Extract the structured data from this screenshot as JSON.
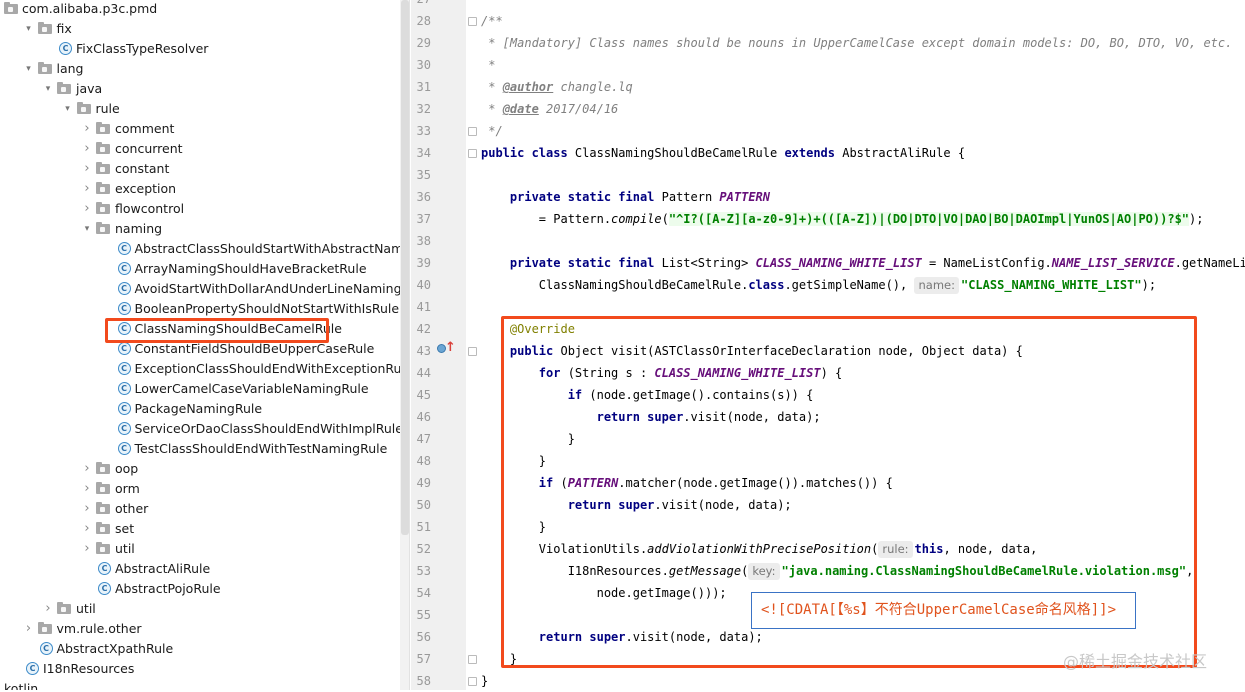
{
  "project_tree": {
    "items": [
      {
        "label": "com.alibaba.p3c.pmd",
        "type": "folder",
        "indent": 0,
        "arrow": ""
      },
      {
        "label": "fix",
        "type": "folder",
        "indent": 1,
        "arrow": "down"
      },
      {
        "label": "FixClassTypeResolver",
        "type": "class",
        "indent": 2,
        "arrow": ""
      },
      {
        "label": "lang",
        "type": "folder",
        "indent": 1,
        "arrow": "down"
      },
      {
        "label": "java",
        "type": "folder",
        "indent": 2,
        "arrow": "down"
      },
      {
        "label": "rule",
        "type": "folder",
        "indent": 3,
        "arrow": "down"
      },
      {
        "label": "comment",
        "type": "folder",
        "indent": 4,
        "arrow": "right"
      },
      {
        "label": "concurrent",
        "type": "folder",
        "indent": 4,
        "arrow": "right"
      },
      {
        "label": "constant",
        "type": "folder",
        "indent": 4,
        "arrow": "right"
      },
      {
        "label": "exception",
        "type": "folder",
        "indent": 4,
        "arrow": "right"
      },
      {
        "label": "flowcontrol",
        "type": "folder",
        "indent": 4,
        "arrow": "right"
      },
      {
        "label": "naming",
        "type": "folder",
        "indent": 4,
        "arrow": "down"
      },
      {
        "label": "AbstractClassShouldStartWithAbstractNamingRule",
        "type": "class",
        "indent": 5,
        "arrow": ""
      },
      {
        "label": "ArrayNamingShouldHaveBracketRule",
        "type": "class",
        "indent": 5,
        "arrow": ""
      },
      {
        "label": "AvoidStartWithDollarAndUnderLineNamingRule",
        "type": "class",
        "indent": 5,
        "arrow": ""
      },
      {
        "label": "BooleanPropertyShouldNotStartWithIsRule",
        "type": "class",
        "indent": 5,
        "arrow": ""
      },
      {
        "label": "ClassNamingShouldBeCamelRule",
        "type": "class",
        "indent": 5,
        "arrow": ""
      },
      {
        "label": "ConstantFieldShouldBeUpperCaseRule",
        "type": "class",
        "indent": 5,
        "arrow": ""
      },
      {
        "label": "ExceptionClassShouldEndWithExceptionRule",
        "type": "class",
        "indent": 5,
        "arrow": ""
      },
      {
        "label": "LowerCamelCaseVariableNamingRule",
        "type": "class",
        "indent": 5,
        "arrow": ""
      },
      {
        "label": "PackageNamingRule",
        "type": "class",
        "indent": 5,
        "arrow": ""
      },
      {
        "label": "ServiceOrDaoClassShouldEndWithImplRule",
        "type": "class",
        "indent": 5,
        "arrow": ""
      },
      {
        "label": "TestClassShouldEndWithTestNamingRule",
        "type": "class",
        "indent": 5,
        "arrow": ""
      },
      {
        "label": "oop",
        "type": "folder",
        "indent": 4,
        "arrow": "right"
      },
      {
        "label": "orm",
        "type": "folder",
        "indent": 4,
        "arrow": "right"
      },
      {
        "label": "other",
        "type": "folder",
        "indent": 4,
        "arrow": "right"
      },
      {
        "label": "set",
        "type": "folder",
        "indent": 4,
        "arrow": "right"
      },
      {
        "label": "util",
        "type": "folder",
        "indent": 4,
        "arrow": "right"
      },
      {
        "label": "AbstractAliRule",
        "type": "class",
        "indent": 4,
        "arrow": ""
      },
      {
        "label": "AbstractPojoRule",
        "type": "class",
        "indent": 4,
        "arrow": ""
      },
      {
        "label": "util",
        "type": "folder",
        "indent": 2,
        "arrow": "right"
      },
      {
        "label": "vm.rule.other",
        "type": "folder",
        "indent": 1,
        "arrow": "right"
      },
      {
        "label": "AbstractXpathRule",
        "type": "class",
        "indent": 1,
        "arrow": ""
      },
      {
        "label": "I18nResources",
        "type": "class",
        "indent": 0,
        "arrow": ""
      },
      {
        "label": "kotlin",
        "type": "text",
        "indent": 0,
        "arrow": ""
      }
    ]
  },
  "editor": {
    "line_numbers": [
      "27",
      "28",
      "29",
      "30",
      "31",
      "32",
      "33",
      "34",
      "35",
      "36",
      "37",
      "38",
      "39",
      "40",
      "41",
      "42",
      "43",
      "44",
      "45",
      "46",
      "47",
      "48",
      "49",
      "50",
      "51",
      "52",
      "53",
      "54",
      "55",
      "56",
      "57",
      "58"
    ],
    "lines": [
      [],
      [
        {
          "t": "/**",
          "c": "cm"
        }
      ],
      [
        {
          "t": " * [Mandatory] Class names should be nouns in UpperCamelCase except domain models: DO, BO, DTO, VO, etc.",
          "c": "cm"
        }
      ],
      [
        {
          "t": " *",
          "c": "cm"
        }
      ],
      [
        {
          "t": " * ",
          "c": "cm"
        },
        {
          "t": "@author",
          "c": "tag"
        },
        {
          "t": " changle.lq",
          "c": "cm"
        }
      ],
      [
        {
          "t": " * ",
          "c": "cm"
        },
        {
          "t": "@date",
          "c": "tag"
        },
        {
          "t": " 2017/04/16",
          "c": "cm"
        }
      ],
      [
        {
          "t": " */",
          "c": "cm"
        }
      ],
      [
        {
          "t": "public class ",
          "c": "kw"
        },
        {
          "t": "ClassNamingShouldBeCamelRule ",
          "c": ""
        },
        {
          "t": "extends ",
          "c": "kw"
        },
        {
          "t": "AbstractAliRule {",
          "c": ""
        }
      ],
      [],
      [
        {
          "t": "    private static final ",
          "c": "kw"
        },
        {
          "t": "Pattern ",
          "c": ""
        },
        {
          "t": "PATTERN",
          "c": "fld"
        }
      ],
      [
        {
          "t": "        = Pattern.",
          "c": ""
        },
        {
          "t": "compile",
          "c": "stat"
        },
        {
          "t": "(",
          "c": ""
        },
        {
          "t": "\"^I?([A-Z][a-z0-9]+)+(([A-Z])|(DO|DTO|VO|DAO|BO|DAOImpl|YunOS|AO|PO))?$\"",
          "c": "strb"
        },
        {
          "t": ");",
          "c": ""
        }
      ],
      [],
      [
        {
          "t": "    private static final ",
          "c": "kw"
        },
        {
          "t": "List<String> ",
          "c": ""
        },
        {
          "t": "CLASS_NAMING_WHITE_LIST",
          "c": "fld"
        },
        {
          "t": " = NameListConfig.",
          "c": ""
        },
        {
          "t": "NAME_LIST_SERVICE",
          "c": "fld"
        },
        {
          "t": ".getNameList(",
          "c": ""
        }
      ],
      [
        {
          "t": "        ClassNamingShouldBeCamelRule.",
          "c": ""
        },
        {
          "t": "class",
          "c": "kw"
        },
        {
          "t": ".getSimpleName(), ",
          "c": ""
        },
        {
          "hint": "name:"
        },
        {
          "t": "\"CLASS_NAMING_WHITE_LIST\"",
          "c": "str"
        },
        {
          "t": ");",
          "c": ""
        }
      ],
      [],
      [
        {
          "t": "    @Override",
          "c": "ann"
        }
      ],
      [
        {
          "t": "    public ",
          "c": "kw"
        },
        {
          "t": "Object visit(ASTClassOrInterfaceDeclaration node, Object data) {",
          "c": ""
        }
      ],
      [
        {
          "t": "        for ",
          "c": "kw"
        },
        {
          "t": "(String s : ",
          "c": ""
        },
        {
          "t": "CLASS_NAMING_WHITE_LIST",
          "c": "fld"
        },
        {
          "t": ") {",
          "c": ""
        }
      ],
      [
        {
          "t": "            if ",
          "c": "kw"
        },
        {
          "t": "(node.getImage().contains(s)) {",
          "c": ""
        }
      ],
      [
        {
          "t": "                return super",
          "c": "kw"
        },
        {
          "t": ".visit(node, data);",
          "c": ""
        }
      ],
      [
        {
          "t": "            }",
          "c": ""
        }
      ],
      [
        {
          "t": "        }",
          "c": ""
        }
      ],
      [
        {
          "t": "        if ",
          "c": "kw"
        },
        {
          "t": "(",
          "c": ""
        },
        {
          "t": "PATTERN",
          "c": "fld"
        },
        {
          "t": ".matcher(node.getImage()).matches()) {",
          "c": ""
        }
      ],
      [
        {
          "t": "            return super",
          "c": "kw"
        },
        {
          "t": ".visit(node, data);",
          "c": ""
        }
      ],
      [
        {
          "t": "        }",
          "c": ""
        }
      ],
      [
        {
          "t": "        ViolationUtils.",
          "c": ""
        },
        {
          "t": "addViolationWithPrecisePosition",
          "c": "stat"
        },
        {
          "t": "(",
          "c": ""
        },
        {
          "hint": "rule:"
        },
        {
          "t": "this",
          "c": "kw"
        },
        {
          "t": ", node, data,",
          "c": ""
        }
      ],
      [
        {
          "t": "            I18nResources.",
          "c": ""
        },
        {
          "t": "getMessage",
          "c": "stat"
        },
        {
          "t": "(",
          "c": ""
        },
        {
          "hint": "key:"
        },
        {
          "t": "\"java.naming.ClassNamingShouldBeCamelRule.violation.msg\"",
          "c": "str"
        },
        {
          "t": ",",
          "c": ""
        }
      ],
      [
        {
          "t": "                node.getImage()));",
          "c": ""
        }
      ],
      [],
      [
        {
          "t": "        return super",
          "c": "kw"
        },
        {
          "t": ".visit(node, data);",
          "c": ""
        }
      ],
      [
        {
          "t": "    }",
          "c": ""
        }
      ],
      [
        {
          "t": "}",
          "c": ""
        }
      ]
    ]
  },
  "tooltip": {
    "text": "<![CDATA[【%s】不符合UpperCamelCase命名风格]]>"
  },
  "watermark": {
    "text": "@稀土掘金技术社区"
  },
  "colors": {
    "highlight": "#f24a1d",
    "tooltip_border": "#3a73c5",
    "tooltip_text": "#e0531d"
  }
}
